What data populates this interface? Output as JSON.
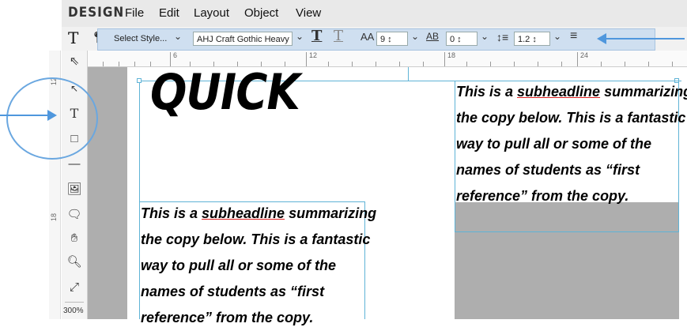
{
  "app": {
    "logo": "DESIGN"
  },
  "menu": [
    "File",
    "Edit",
    "Layout",
    "Object",
    "View"
  ],
  "toolbar": {
    "text_tool_icon": "T",
    "select_style": "Select Style...",
    "font_name": "AHJ Craft Gothic Heavy Co",
    "font_size_label": "AA",
    "font_size": "9",
    "kerning_label": "AB",
    "kerning": "0",
    "leading": "1.2",
    "icons": [
      "pin-icon",
      "chevron-down-icon",
      "text-fill-icon",
      "text-outline-icon",
      "align-left-icon"
    ]
  },
  "tools": [
    "pointer-icon",
    "direct-select-icon",
    "text-icon",
    "rectangle-icon",
    "line-icon",
    "image-frame-icon",
    "comment-icon",
    "hand-icon",
    "zoom-icon",
    "fit-icon"
  ],
  "zoom": "300%",
  "ruler": {
    "labels": [
      "6",
      "12",
      "18",
      "24"
    ]
  },
  "vruler": {
    "labels": [
      "12",
      "18"
    ]
  },
  "document": {
    "headline": "QUICK",
    "copy_right": [
      {
        "pre": "This is a ",
        "u": "subheadline",
        "post": " summarizing"
      },
      {
        "pre": "the copy below. This is a fantastic",
        "u": "",
        "post": ""
      },
      {
        "pre": "way to pull all or some of the",
        "u": "",
        "post": ""
      },
      {
        "pre": "names of students as “first",
        "u": "",
        "post": ""
      },
      {
        "pre": "reference” from the copy.",
        "u": "",
        "post": ""
      }
    ],
    "copy_left": [
      {
        "pre": "This is a ",
        "u": "subheadline",
        "post": " summarizing"
      },
      {
        "pre": "the copy below. This is a fantastic",
        "u": "",
        "post": ""
      },
      {
        "pre": "way to pull all or some of the",
        "u": "",
        "post": ""
      },
      {
        "pre": "names of students as “first",
        "u": "",
        "post": ""
      },
      {
        "pre": "reference” from the copy.",
        "u": "",
        "post": ""
      }
    ]
  },
  "colors": {
    "annotation": "#4f97dd",
    "frame": "#5fb3d6",
    "toolbar_highlight": "#cfdff0"
  }
}
